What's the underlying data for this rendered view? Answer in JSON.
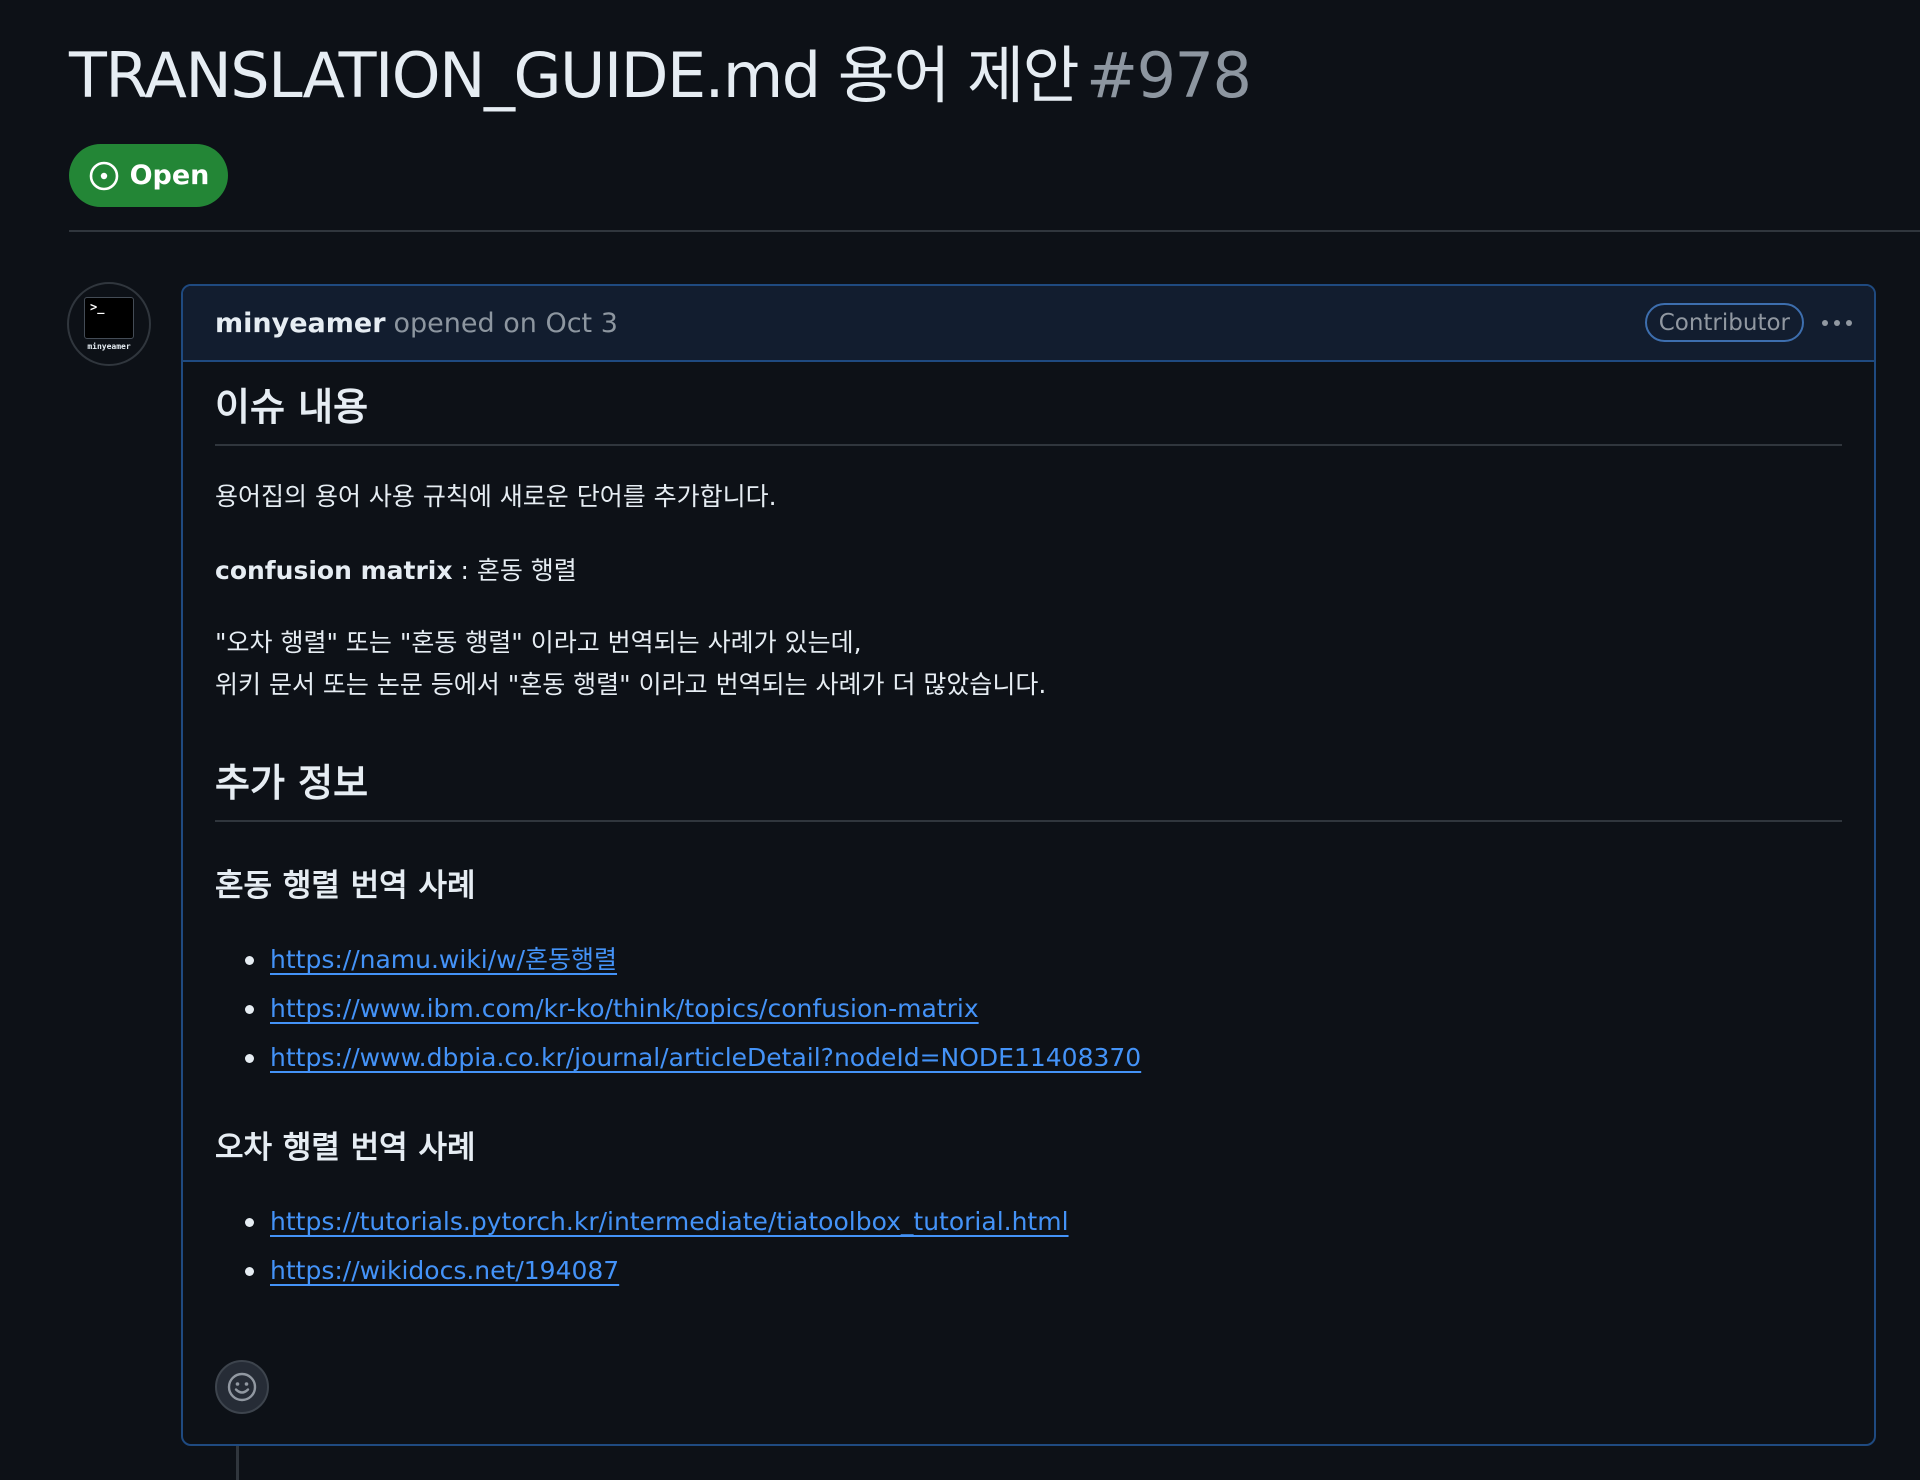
{
  "issue": {
    "title": "TRANSLATION_GUIDE.md 용어 제안",
    "number": "#978",
    "state": "Open",
    "state_color": "#238636"
  },
  "comment": {
    "author": "minyeamer",
    "avatar_label": "minyeamer",
    "avatar_prompt": ">_",
    "meta": "opened on Oct 3",
    "role": "Contributor",
    "heading_issue": "이슈 내용",
    "intro": "용어집의 용어 사용 규칙에 새로운 단어를 추가합니다.",
    "term_en": "confusion matrix",
    "term_sep": " : ",
    "term_ko": "혼동 행렬",
    "reason_line1": "\"오차 행렬\" 또는 \"혼동 행렬\" 이라고 번역되는 사례가 있는데,",
    "reason_line2": "위키 문서 또는 논문 등에서 \"혼동 행렬\" 이라고 번역되는 사례가 더 많았습니다.",
    "heading_extra": "추가 정보",
    "section1_title": "혼동 행렬 번역 사례",
    "section1_links": [
      "https://namu.wiki/w/혼동행렬",
      "https://www.ibm.com/kr-ko/think/topics/confusion-matrix",
      "https://www.dbpia.co.kr/journal/articleDetail?nodeId=NODE11408370"
    ],
    "section2_title": "오차 행렬 번역 사례",
    "section2_links": [
      "https://tutorials.pytorch.kr/intermediate/tiatoolbox_tutorial.html",
      "https://wikidocs.net/194087"
    ]
  },
  "colors": {
    "background": "#0d1117",
    "link": "#4493f8",
    "border_accent": "#1f4a80"
  },
  "icons": {
    "state": "issue-opened-icon",
    "menu": "kebab-horizontal-icon",
    "reaction": "smiley-icon"
  }
}
